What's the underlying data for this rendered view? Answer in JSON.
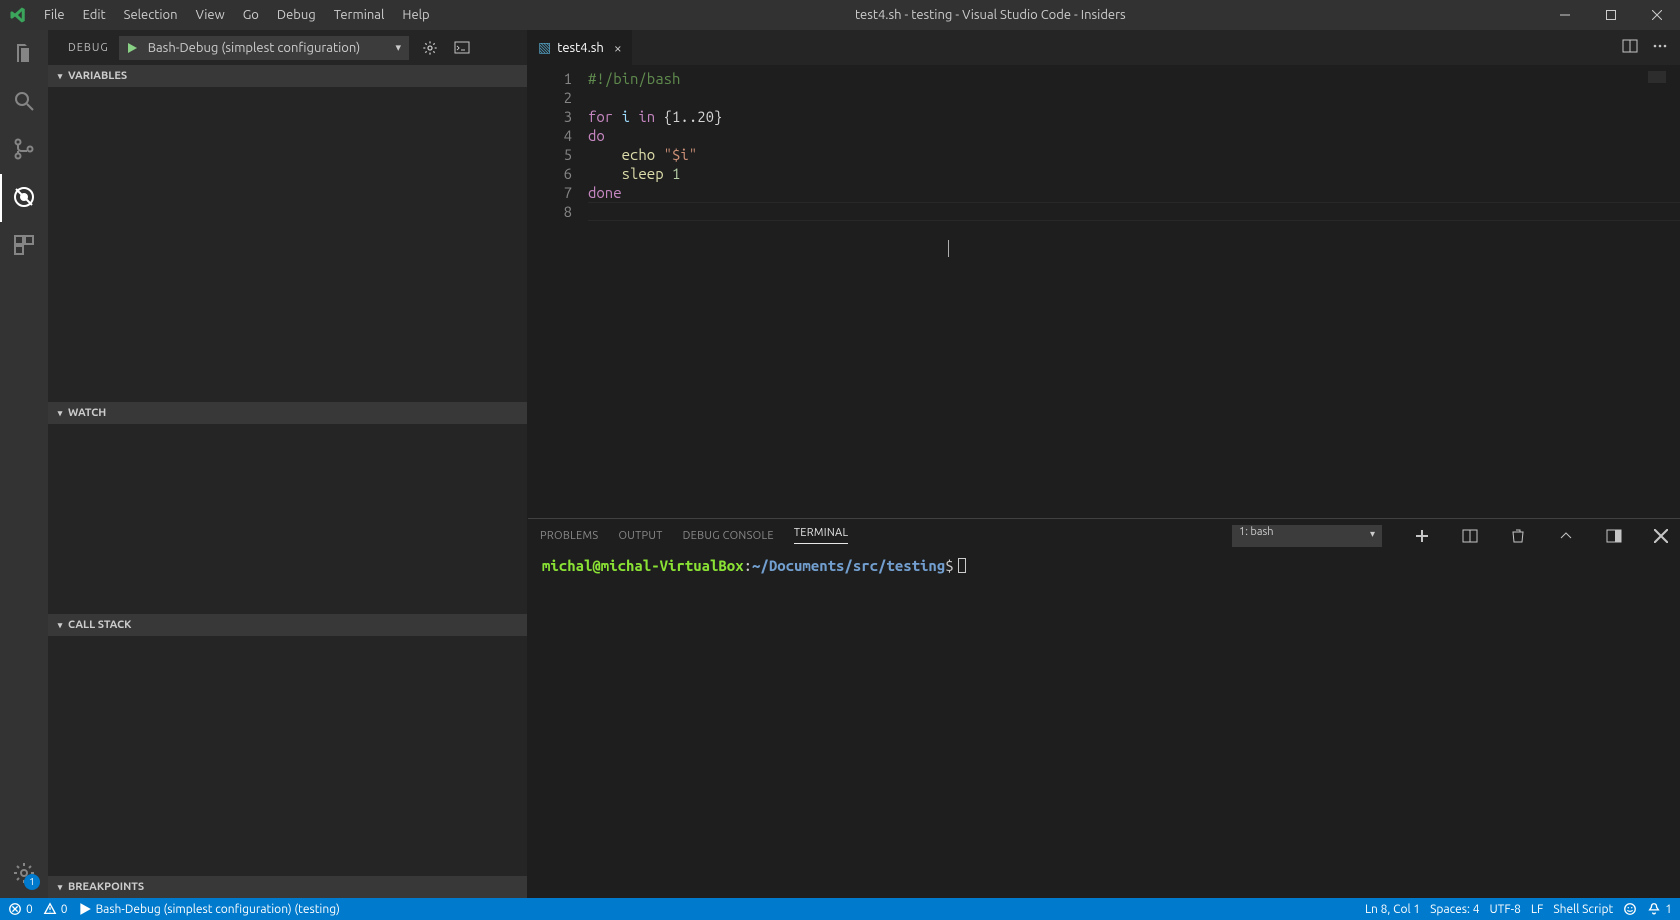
{
  "window": {
    "title": "test4.sh - testing - Visual Studio Code - Insiders"
  },
  "menubar": [
    "File",
    "Edit",
    "Selection",
    "View",
    "Go",
    "Debug",
    "Terminal",
    "Help"
  ],
  "activitybar": {
    "settings_badge": "1"
  },
  "sidebar": {
    "title": "DEBUG",
    "launch_config": "Bash-Debug (simplest configuration)",
    "sections": {
      "variables": "VARIABLES",
      "watch": "WATCH",
      "callstack": "CALL STACK",
      "breakpoints": "BREAKPOINTS"
    }
  },
  "editor": {
    "tab_name": "test4.sh",
    "line_numbers": [
      "1",
      "2",
      "3",
      "4",
      "5",
      "6",
      "7",
      "8"
    ],
    "lines": {
      "l1_comment": "#!/bin/bash",
      "l3_for": "for",
      "l3_i": " i ",
      "l3_in": "in",
      "l3_range": " {1..20}",
      "l4_do": "do",
      "l5_echo": "    echo",
      "l5_str": " \"$i\"",
      "l6_sleep": "    sleep",
      "l6_num": " 1",
      "l7_done": "done"
    }
  },
  "panel": {
    "tabs": {
      "problems": "PROBLEMS",
      "output": "OUTPUT",
      "debug_console": "DEBUG CONSOLE",
      "terminal": "TERMINAL"
    },
    "terminal_selector": "1: bash",
    "prompt": {
      "userhost": "michal@michal-VirtualBox",
      "colon": ":",
      "path": "~/Documents/src/testing",
      "dollar": "$"
    }
  },
  "statusbar": {
    "errors": "0",
    "warnings": "0",
    "debug_target": "Bash-Debug (simplest configuration) (testing)",
    "position": "Ln 8, Col 1",
    "spaces": "Spaces: 4",
    "encoding": "UTF-8",
    "eol": "LF",
    "language": "Shell Script",
    "notifications": "1"
  }
}
